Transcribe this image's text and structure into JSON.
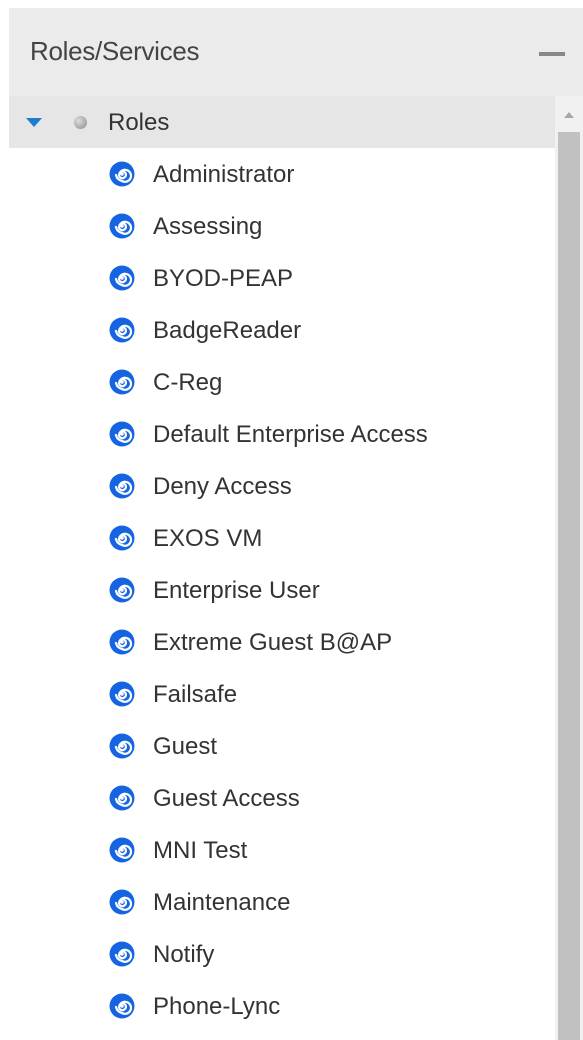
{
  "panel": {
    "title": "Roles/Services"
  },
  "tree": {
    "root_label": "Roles",
    "roles": [
      "Administrator",
      "Assessing",
      "BYOD-PEAP",
      "BadgeReader",
      "C-Reg",
      "Default Enterprise Access",
      "Deny Access",
      "EXOS VM",
      "Enterprise User",
      "Extreme Guest B@AP",
      "Failsafe",
      "Guest",
      "Guest Access",
      "MNI Test",
      "Maintenance",
      "Notify",
      "Phone-Lync"
    ]
  },
  "colors": {
    "accent": "#1f7ad1",
    "role_icon": "#1565e0",
    "header_bg": "#ebebeb",
    "selected_bg": "#e6e6e6"
  },
  "icons": {
    "expand": "caret-down-icon",
    "root": "gray-bullet-icon",
    "role": "role-swirl-icon",
    "collapse": "minus-icon"
  }
}
